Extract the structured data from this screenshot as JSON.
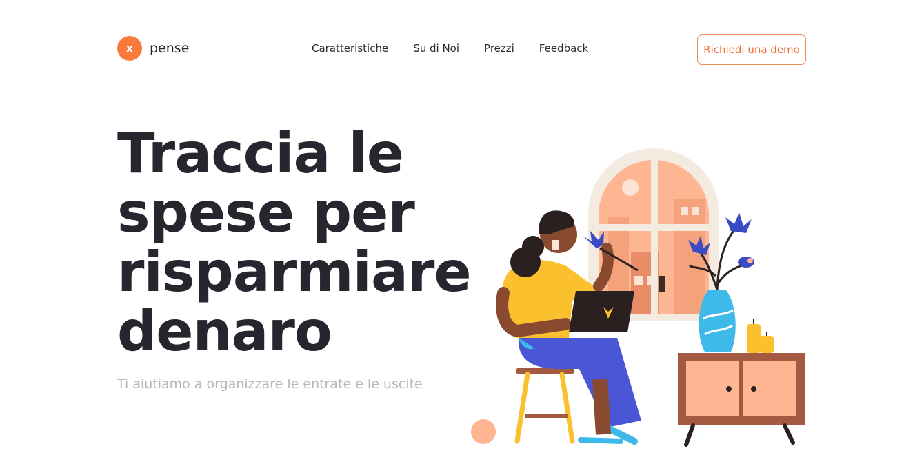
{
  "brand": {
    "badge": "x",
    "name": "pense",
    "accent": "#f97a3c"
  },
  "nav": {
    "items": [
      {
        "label": "Caratteristiche"
      },
      {
        "label": "Su di Noi"
      },
      {
        "label": "Prezzi"
      },
      {
        "label": "Feedback"
      }
    ],
    "cta_label": "Richiedi una demo"
  },
  "hero": {
    "title_lines": [
      "Traccia le",
      "spese per",
      "risparmiare",
      "denaro"
    ],
    "subtitle": "Ti aiutiamo a organizzare le entrate e le uscite"
  },
  "illustration": {
    "icon": "woman-with-laptop-illustration"
  }
}
